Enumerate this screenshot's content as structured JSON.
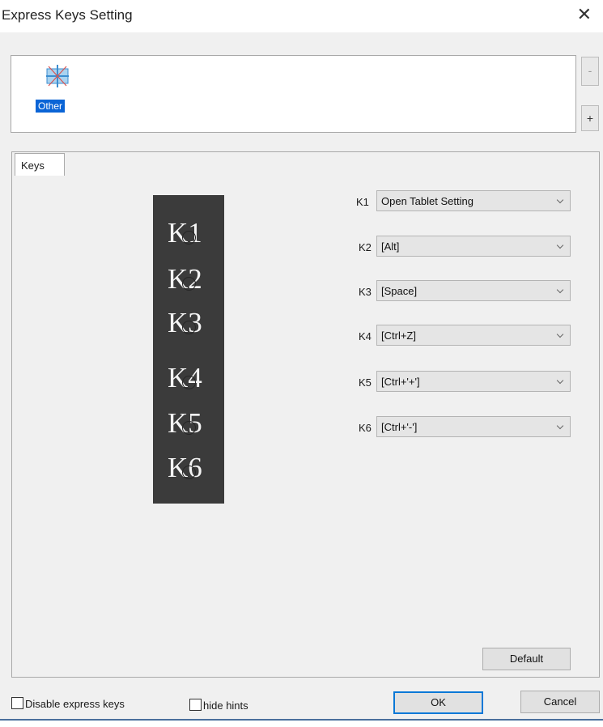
{
  "window": {
    "title": "Express Keys Setting",
    "close_glyph": "✕"
  },
  "app_list": {
    "items": [
      {
        "label": "Other",
        "icon": "other-app-icon",
        "selected": true
      }
    ],
    "minus_label": "-",
    "plus_label": "+"
  },
  "tabs": [
    {
      "label": "Keys",
      "active": true
    }
  ],
  "device": {
    "keys": [
      "K1",
      "K2",
      "K3",
      "K4",
      "K5",
      "K6"
    ]
  },
  "key_settings": [
    {
      "key": "K1",
      "value": "Open Tablet Setting"
    },
    {
      "key": "K2",
      "value": "[Alt]"
    },
    {
      "key": "K3",
      "value": "[Space]"
    },
    {
      "key": "K4",
      "value": "[Ctrl+Z]"
    },
    {
      "key": "K5",
      "value": "[Ctrl+'+']"
    },
    {
      "key": "K6",
      "value": "[Ctrl+'-']"
    }
  ],
  "buttons": {
    "default": "Default",
    "ok": "OK",
    "cancel": "Cancel"
  },
  "checkboxes": {
    "disable_express_keys": {
      "label": "Disable express keys",
      "checked": false
    },
    "hide_hints": {
      "label": "hide hints",
      "checked": false
    }
  },
  "colors": {
    "selection": "#0a64d6",
    "dialog_bg": "#f0f0f0",
    "ok_border": "#0b78d7",
    "device": "#3b3b3b"
  }
}
